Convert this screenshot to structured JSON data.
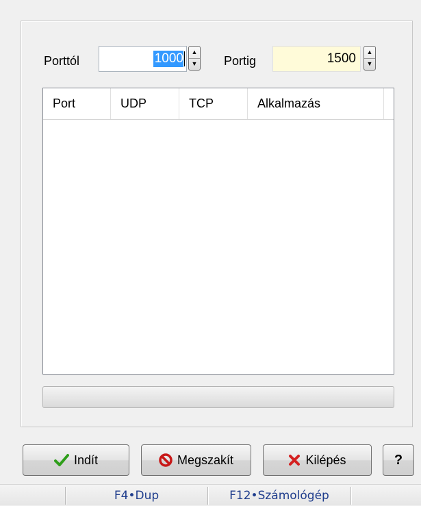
{
  "range": {
    "from_label": "Porttól",
    "from_value": "1000",
    "to_label": "Portig",
    "to_value": "1500"
  },
  "table": {
    "columns": [
      "Port",
      "UDP",
      "TCP",
      "Alkalmazás"
    ],
    "rows": []
  },
  "progress": {
    "value": 0
  },
  "buttons": {
    "start": "Indít",
    "abort": "Megszakít",
    "exit": "Kilépés",
    "help": "?"
  },
  "statusbar": {
    "items": [
      "F4•Dup",
      "F12•Számológép"
    ]
  },
  "colors": {
    "selection": "#3399ff",
    "highlight_field": "#fffbd9",
    "check": "#2e9e1a",
    "exit_x": "#d42020",
    "status_text": "#1e3c8c"
  }
}
